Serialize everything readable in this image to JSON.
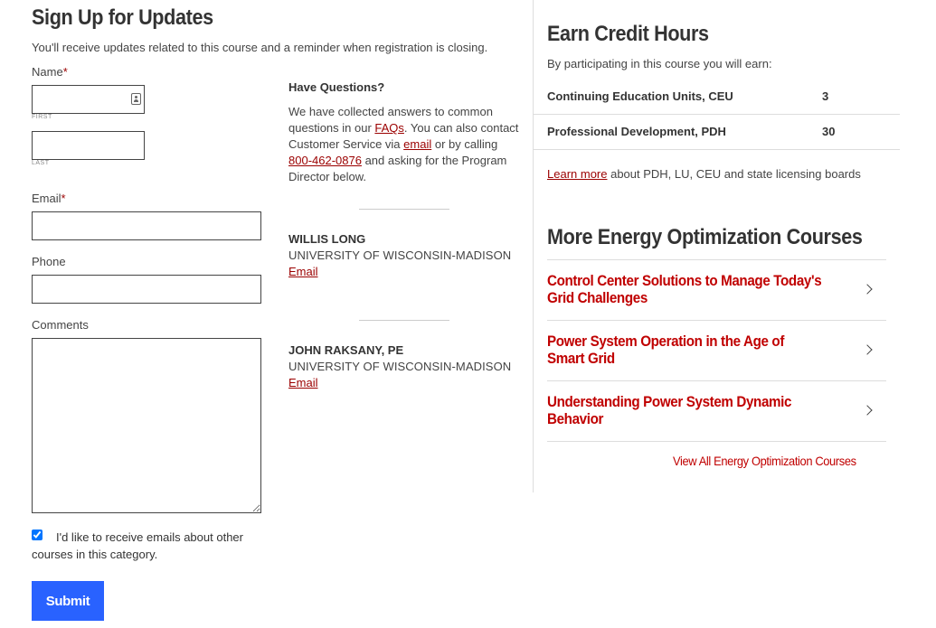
{
  "signup": {
    "title": "Sign Up for Updates",
    "subtitle": "You'll receive updates related to this course and a reminder when registration is closing.",
    "name_label": "Name",
    "required_mark": "*",
    "first_caption": "FIRST",
    "last_caption": "LAST",
    "first_value": "",
    "last_value": "",
    "email_label": "Email",
    "email_value": "",
    "phone_label": "Phone",
    "phone_value": "",
    "comments_label": "Comments",
    "comments_value": "",
    "optin_checked": true,
    "optin_label": "I'd like to receive emails about other courses in this category.",
    "submit_label": "Submit"
  },
  "questions": {
    "heading": "Have Questions?",
    "text_1": "We have collected answers to common questions in our ",
    "faqs_link": "FAQs",
    "text_2": ". You can also contact Customer Service via ",
    "email_link": "email",
    "text_3": " or by calling ",
    "phone_link": "800-462-0876",
    "text_4": " and asking for the Program Director below.",
    "contacts": [
      {
        "name": "WILLIS LONG",
        "org": "UNIVERSITY OF WISCONSIN-MADISON",
        "link": "Email"
      },
      {
        "name": "JOHN RAKSANY, PE",
        "org": "UNIVERSITY OF WISCONSIN-MADISON",
        "link": "Email"
      }
    ]
  },
  "credits": {
    "title": "Earn Credit Hours",
    "subtitle": "By participating in this course you will earn:",
    "rows": [
      {
        "name": "Continuing Education Units, CEU",
        "value": "3"
      },
      {
        "name": "Professional Development, PDH",
        "value": "30"
      }
    ],
    "learn_more_link": "Learn more",
    "learn_more_text": " about PDH, LU, CEU and state licensing boards"
  },
  "more_courses": {
    "title": "More Energy Optimization Courses",
    "items": [
      {
        "label": "Control Center Solutions to Manage Today's Grid Challenges",
        "icon": "chevron-right-icon"
      },
      {
        "label": "Power System Operation in the Age of Smart Grid",
        "icon": "chevron-right-icon"
      },
      {
        "label": "Understanding Power System Dynamic Behavior",
        "icon": "chevron-right-icon"
      }
    ],
    "view_all": "View All Energy Optimization Courses"
  },
  "colors": {
    "link_red": "#9b0000",
    "course_red": "#c00000",
    "submit_blue": "#2962ff"
  }
}
